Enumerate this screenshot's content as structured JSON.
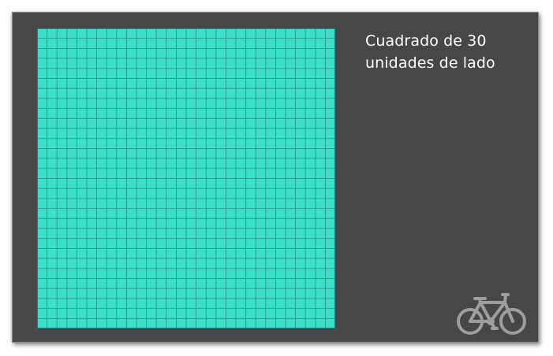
{
  "title": {
    "line1": "Cuadrado de 30",
    "line2": "unidades de lado"
  },
  "grid": {
    "units_per_side": 30,
    "fill_color": "#3ddfc9",
    "line_color": "#1f9c8a",
    "border_color": "#1a8a7a"
  },
  "colors": {
    "background": "#474747",
    "text": "#ffffff",
    "icon": "#9e9e9e"
  },
  "icon": "bicycle-icon"
}
